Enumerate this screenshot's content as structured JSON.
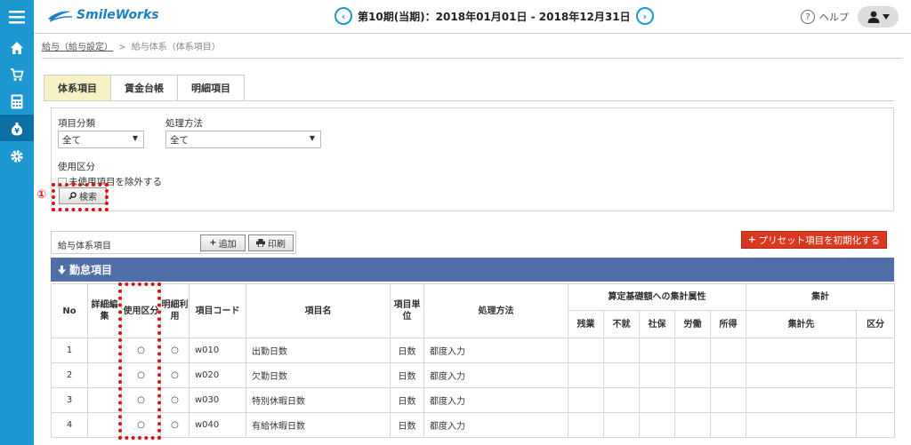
{
  "header": {
    "logo_text": "SmileWorks",
    "prev_arrow": "‹",
    "next_arrow": "›",
    "period": "第10期(当期)：2018年01月01日 - 2018年12月31日",
    "help_label": "ヘルプ",
    "help_glyph": "?"
  },
  "breadcrumb": {
    "parent": "給与（給与設定）",
    "separator": ">",
    "current": "給与体系（体系項目）"
  },
  "tabs": [
    {
      "label": "体系項目",
      "active": true
    },
    {
      "label": "賃金台帳",
      "active": false
    },
    {
      "label": "明細項目",
      "active": false
    }
  ],
  "filter": {
    "item_category_label": "項目分類",
    "item_category_value": "全て",
    "processing_label": "処理方法",
    "processing_value": "全て",
    "usage_label": "使用区分",
    "exclude_unused_label": "未使用項目を除外する",
    "search_label": "検索"
  },
  "annotation": {
    "marker": "①"
  },
  "list": {
    "title": "給与体系項目",
    "add_label": "追加",
    "print_label": "印刷",
    "preset_label": "プリセット項目を初期化する",
    "category": "勤怠項目"
  },
  "table": {
    "headers": {
      "no": "No",
      "edit": "詳細編集",
      "usage": "使用区分",
      "detail_use": "明細利用",
      "code": "項目コード",
      "name": "項目名",
      "unit": "項目単位",
      "method": "処理方法",
      "calc_group": "算定基礎額への集計属性",
      "calc_cols": [
        "残業",
        "不就",
        "社保",
        "労働",
        "所得"
      ],
      "total_group": "集計",
      "total_dest": "集計先",
      "total_kind": "区分"
    },
    "rows": [
      {
        "no": "1",
        "usage": "○",
        "detail": "○",
        "code": "w010",
        "name": "出勤日数",
        "unit": "日数",
        "method": "都度入力"
      },
      {
        "no": "2",
        "usage": "○",
        "detail": "○",
        "code": "w020",
        "name": "欠勤日数",
        "unit": "日数",
        "method": "都度入力"
      },
      {
        "no": "3",
        "usage": "○",
        "detail": "○",
        "code": "w030",
        "name": "特別休暇日数",
        "unit": "日数",
        "method": "都度入力"
      },
      {
        "no": "4",
        "usage": "○",
        "detail": "○",
        "code": "w040",
        "name": "有給休暇日数",
        "unit": "日数",
        "method": "都度入力"
      }
    ]
  },
  "colors": {
    "sidebar": "#1c97cf",
    "category_bar": "#506fa9",
    "preset_button": "#d9371f",
    "active_tab": "#f7f1c6",
    "annotation": "#e01010",
    "link": "#1c7fc4"
  }
}
